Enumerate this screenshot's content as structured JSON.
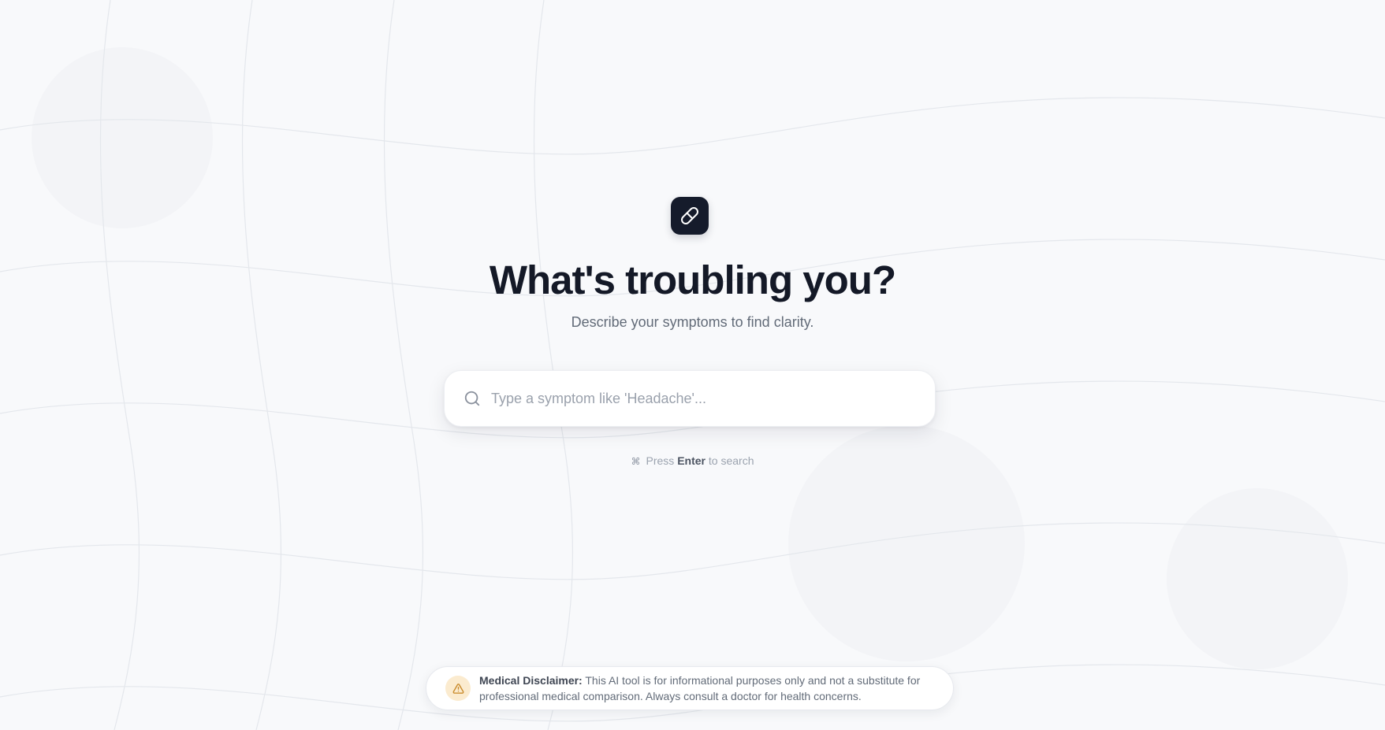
{
  "hero": {
    "logo_icon": "pill-icon",
    "title": "What's troubling you?",
    "subtitle": "Describe your symptoms to find clarity."
  },
  "search": {
    "icon": "search-icon",
    "placeholder": "Type a symptom like 'Headache'...",
    "value": ""
  },
  "hint": {
    "symbol": "⌘",
    "prefix": "Press",
    "key": "Enter",
    "suffix": "to search"
  },
  "disclaimer": {
    "icon": "warning-icon",
    "heading": "Medical Disclaimer:",
    "text": "This AI tool is for informational purposes only and not a substitute for professional medical comparison. Always consult a doctor for health concerns."
  },
  "colors": {
    "background": "#f8f9fb",
    "logo_background": "#151b2b",
    "title": "#141927",
    "warning_badge": "#fbebcf",
    "warning_icon": "#c98a2a"
  }
}
